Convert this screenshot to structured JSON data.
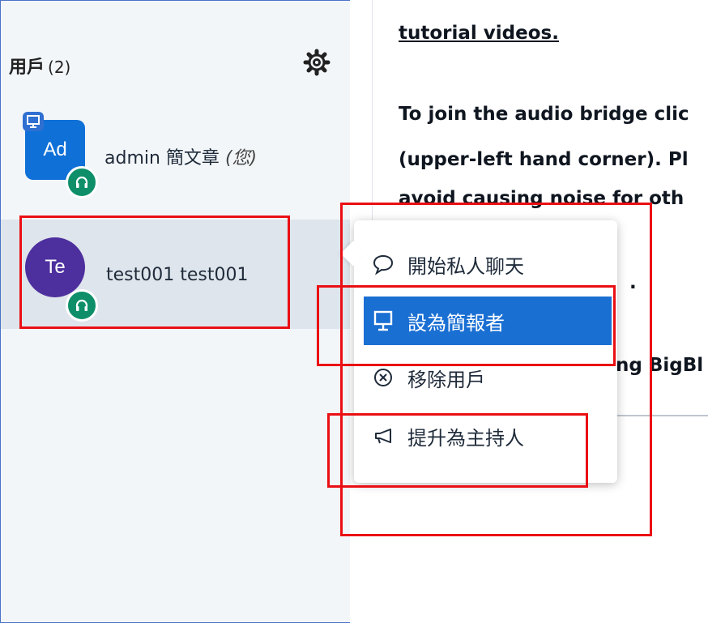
{
  "userlist": {
    "title": "用戶",
    "count": "(2)",
    "users": [
      {
        "initials": "Ad",
        "name": "admin 簡文章",
        "you_label": "(您)",
        "color": "#0f70d7"
      },
      {
        "initials": "Te",
        "name": "test001 test001",
        "color": "#4d2f9e"
      }
    ]
  },
  "chat": {
    "lines": [
      "tutorial videos.",
      "To join the audio bridge clic",
      "(upper-left hand corner). Pl",
      "avoid causing noise for oth",
      ".",
      "ng BigBl"
    ]
  },
  "menu": {
    "items": [
      {
        "label": "開始私人聊天",
        "icon": "chat-bubble-icon"
      },
      {
        "label": "設為簡報者",
        "icon": "presentation-icon"
      },
      {
        "label": "移除用戶",
        "icon": "remove-circle-icon"
      },
      {
        "label": "提升為主持人",
        "icon": "megaphone-icon"
      }
    ]
  },
  "colors": {
    "accent": "#1a6fd3",
    "annotation": "#ea0f14",
    "audio_badge": "#0e8f6a"
  }
}
